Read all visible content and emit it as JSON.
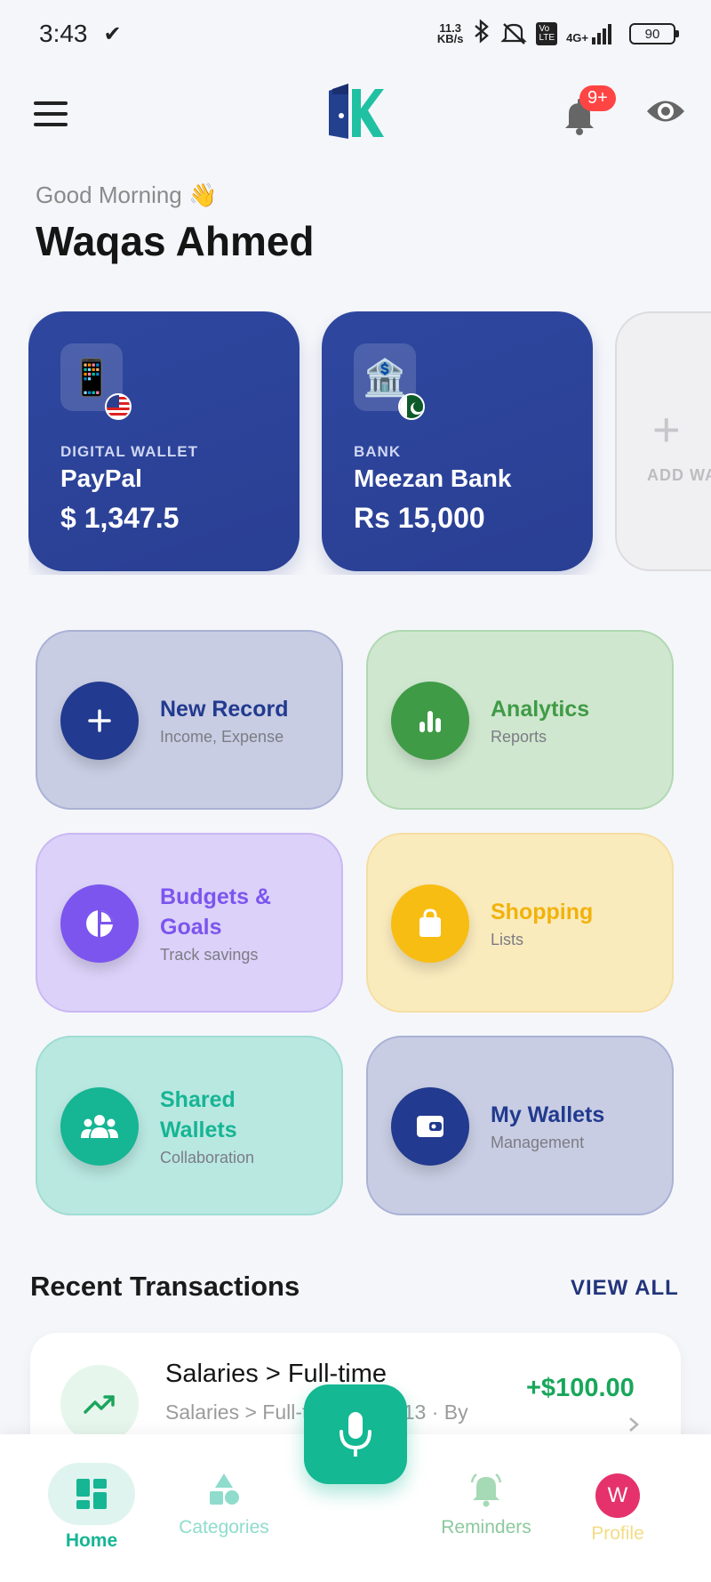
{
  "status_bar": {
    "time": "3:43",
    "net_speed_value": "11.3",
    "net_speed_unit": "KB/s",
    "battery": "90",
    "network": "4G+"
  },
  "header": {
    "notification_badge": "9+"
  },
  "greeting": {
    "salutation": "Good Morning 👋",
    "name": "Waqas Ahmed"
  },
  "wallets": [
    {
      "type": "DIGITAL WALLET",
      "name": "PayPal",
      "balance": "$ 1,347.5",
      "icon": "📱"
    },
    {
      "type": "BANK",
      "name": "Meezan Bank",
      "balance": "Rs  15,000",
      "icon": "🏦"
    }
  ],
  "add_wallet": {
    "plus": "+",
    "label": "ADD WALLET"
  },
  "actions": [
    {
      "title": "New Record",
      "subtitle": "Income, Expense",
      "color": "#223a8f"
    },
    {
      "title": "Analytics",
      "subtitle": "Reports",
      "color": "#3f9b46"
    },
    {
      "title": "Budgets & Goals",
      "subtitle": "Track savings",
      "color": "#7b55ee"
    },
    {
      "title": "Shopping",
      "subtitle": "Lists",
      "color": "#f8bd12"
    },
    {
      "title": "Shared Wallets",
      "subtitle": "Collaboration",
      "color": "#16b594"
    },
    {
      "title": "My Wallets",
      "subtitle": "Management",
      "color": "#223a8f"
    }
  ],
  "recent": {
    "title": "Recent Transactions",
    "view_all": "VIEW ALL",
    "item": {
      "title": "Salaries > Full-time",
      "subtitle": "Salaries > Full-time · May 13 · By",
      "amount": "+$100.00"
    }
  },
  "nav": {
    "home": "Home",
    "categories": "Categories",
    "reminders": "Reminders",
    "profile": "Profile",
    "avatar_initial": "W"
  }
}
